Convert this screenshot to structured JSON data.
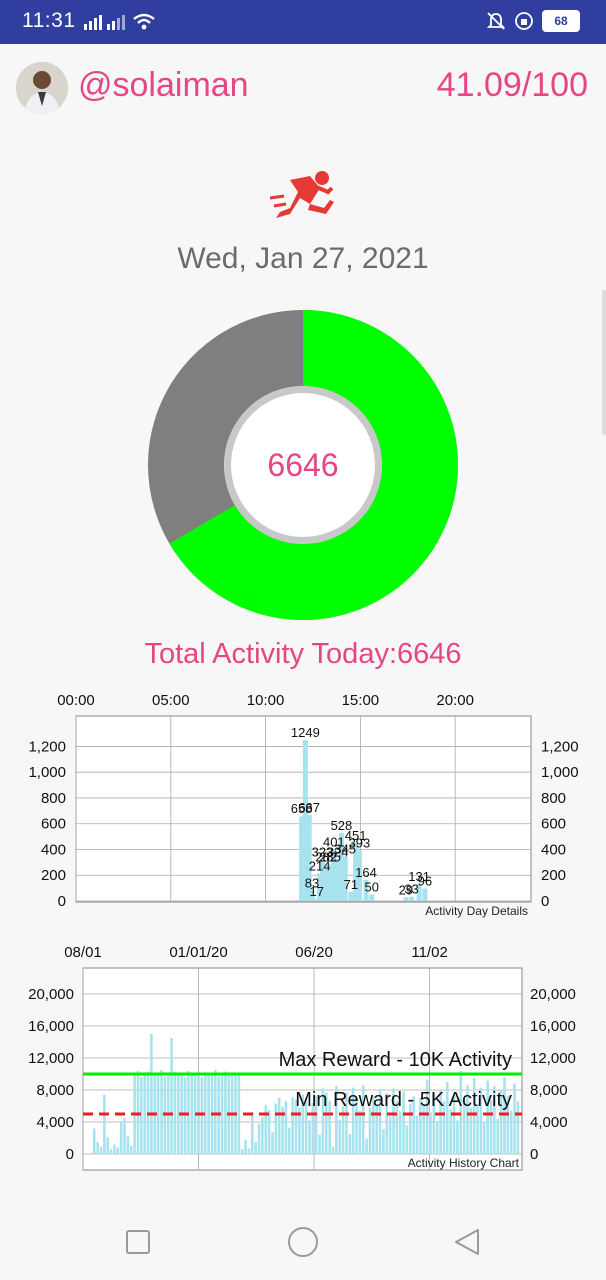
{
  "status": {
    "time": "11:31",
    "battery": "68"
  },
  "header": {
    "username": "@solaiman",
    "score": "41.09/100"
  },
  "date": "Wed, Jan 27, 2021",
  "donut": {
    "center_value": "6646",
    "colors": {
      "done": "#00ff00",
      "remaining": "#7f7f7f",
      "ring": "#c8c8c8"
    },
    "done_fraction": 0.665
  },
  "total_label": "Total Activity Today:6646",
  "colors": {
    "accent": "#e64683",
    "bar": "#a6e3ef",
    "max_line": "#00ee00",
    "min_line": "#e52222"
  },
  "chart_data": [
    {
      "type": "bar",
      "title": "Activity Day Details",
      "x_ticks": [
        "00:00",
        "05:00",
        "10:00",
        "15:00",
        "20:00"
      ],
      "y_ticks": [
        "0",
        "200",
        "400",
        "600",
        "800",
        "1,000",
        "1,200"
      ],
      "ylim": [
        0,
        1300
      ],
      "x_range_hours": [
        0,
        24
      ],
      "bars": [
        {
          "x": 11.9,
          "y": 658,
          "label": "658"
        },
        {
          "x": 12.1,
          "y": 1249,
          "label": "1249"
        },
        {
          "x": 12.3,
          "y": 667,
          "label": "667"
        },
        {
          "x": 12.45,
          "y": 83,
          "label": "83"
        },
        {
          "x": 12.7,
          "y": 17,
          "label": "17"
        },
        {
          "x": 12.85,
          "y": 214,
          "label": "214"
        },
        {
          "x": 13.0,
          "y": 323,
          "label": "323"
        },
        {
          "x": 13.2,
          "y": 282,
          "label": "282"
        },
        {
          "x": 13.4,
          "y": 285,
          "label": "285"
        },
        {
          "x": 13.6,
          "y": 401,
          "label": "401"
        },
        {
          "x": 13.8,
          "y": 324,
          "label": "324"
        },
        {
          "x": 14.0,
          "y": 528,
          "label": "528"
        },
        {
          "x": 14.2,
          "y": 345,
          "label": "345"
        },
        {
          "x": 14.5,
          "y": 71,
          "label": "71"
        },
        {
          "x": 14.75,
          "y": 451,
          "label": "451"
        },
        {
          "x": 14.95,
          "y": 393,
          "label": "393"
        },
        {
          "x": 15.3,
          "y": 164,
          "label": "164"
        },
        {
          "x": 15.6,
          "y": 50,
          "label": "50"
        },
        {
          "x": 17.4,
          "y": 29,
          "label": "29"
        },
        {
          "x": 17.7,
          "y": 33,
          "label": "33"
        },
        {
          "x": 18.1,
          "y": 131,
          "label": "131"
        },
        {
          "x": 18.4,
          "y": 96,
          "label": "96"
        }
      ]
    },
    {
      "type": "bar",
      "title": "Activity History Chart",
      "x_ticks": [
        "08/01",
        "01/01/20",
        "06/20",
        "11/02"
      ],
      "y_ticks": [
        "0",
        "4,000",
        "8,000",
        "12,000",
        "16,000",
        "20,000"
      ],
      "ylim": [
        0,
        22000
      ],
      "lines": [
        {
          "name": "Max Reward - 10K Activity",
          "y": 10000,
          "style": "solid"
        },
        {
          "name": "Min Reward - 5K Activity",
          "y": 5000,
          "style": "dashed"
        }
      ],
      "values": [
        3200,
        1500,
        900,
        7400,
        2100,
        600,
        1200,
        800,
        3900,
        4500,
        2200,
        1000,
        9800,
        10400,
        9600,
        10100,
        10300,
        15000,
        10200,
        9900,
        10500,
        9700,
        10100,
        14500,
        10300,
        9800,
        10200,
        9600,
        10400,
        10000,
        9900,
        10300,
        9600,
        10200,
        9800,
        10100,
        10500,
        9700,
        10000,
        10300,
        9800,
        10200,
        10100,
        9900,
        600,
        1800,
        700,
        5200,
        1500,
        3800,
        4600,
        6100,
        5500,
        2700,
        6300,
        7000,
        5900,
        6600,
        3300,
        7100,
        6800,
        5800,
        7400,
        6900,
        4200,
        6400,
        7300,
        2400,
        8200,
        7700,
        6600,
        900,
        8500,
        4300,
        6000,
        7700,
        2500,
        8300,
        7100,
        5400,
        8600,
        1900,
        5800,
        7200,
        6000,
        8100,
        3100,
        7600,
        4700,
        8200,
        6600,
        5300,
        7800,
        3600,
        6300,
        7200,
        4800,
        7000,
        6100,
        9300,
        5200,
        7600,
        4100,
        8000,
        6600,
        9000,
        5600,
        7300,
        4200,
        10400,
        6900,
        8600,
        5800,
        9500,
        6200,
        8300,
        3900,
        9200,
        6800,
        8500,
        4400,
        7900,
        9600,
        7300,
        5400,
        8800,
        6600
      ]
    }
  ]
}
